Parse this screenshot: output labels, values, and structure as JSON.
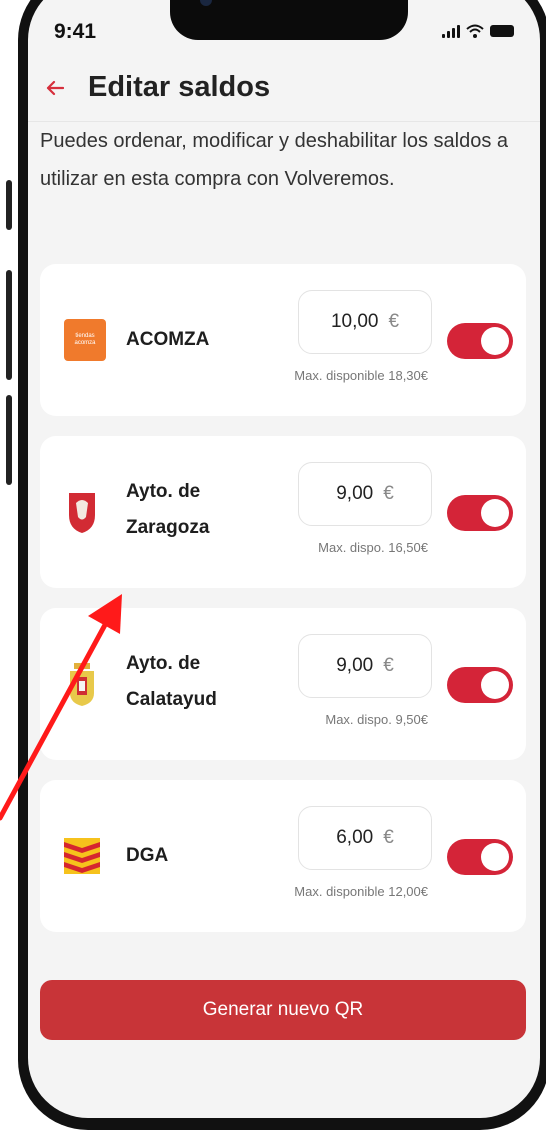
{
  "status_bar": {
    "time": "9:41"
  },
  "header": {
    "title": "Editar saldos"
  },
  "intro_text": "Puedes ordenar, modificar y deshabilitar los saldos a utilizar en esta compra con Volveremos.",
  "balances": [
    {
      "name_line1": "ACOMZA",
      "name_line2": "",
      "amount": "10,00",
      "currency": "€",
      "max": "Max. disponible 18,30€",
      "enabled": true,
      "logo": "acomza-logo-icon",
      "logo_text": "tiendas acomza"
    },
    {
      "name_line1": "Ayto. de",
      "name_line2": "Zaragoza",
      "amount": "9,00",
      "currency": "€",
      "max": "Max. dispo. 16,50€",
      "enabled": true,
      "logo": "zaragoza-shield-icon"
    },
    {
      "name_line1": "Ayto. de",
      "name_line2": "Calatayud",
      "amount": "9,00",
      "currency": "€",
      "max": "Max. dispo. 9,50€",
      "enabled": true,
      "logo": "calatayud-shield-icon"
    },
    {
      "name_line1": "DGA",
      "name_line2": "",
      "amount": "6,00",
      "currency": "€",
      "max": "Max. disponible 12,00€",
      "enabled": true,
      "logo": "aragon-flag-icon"
    }
  ],
  "cta": {
    "label": "Generar nuevo QR"
  },
  "colors": {
    "accent": "#d42438",
    "cta": "#c83438",
    "annotation_arrow": "#ff1a1a"
  }
}
